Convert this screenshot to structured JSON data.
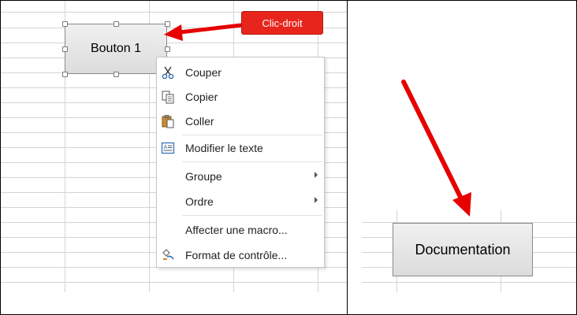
{
  "sheet_button": {
    "label": "Bouton 1"
  },
  "callout": {
    "label": "Clic-droit",
    "color": "#e8251c"
  },
  "context_menu": {
    "items": [
      {
        "label": "Couper",
        "icon": "scissors-icon",
        "submenu": false
      },
      {
        "label": "Copier",
        "icon": "copy-icon",
        "submenu": false
      },
      {
        "label": "Coller",
        "icon": "paste-icon",
        "submenu": false
      },
      {
        "label": "Modifier le texte",
        "icon": "edit-text-icon",
        "submenu": false
      },
      {
        "label": "Groupe",
        "icon": "",
        "submenu": true
      },
      {
        "label": "Ordre",
        "icon": "",
        "submenu": true
      },
      {
        "label": "Affecter une macro...",
        "icon": "",
        "submenu": false
      },
      {
        "label": "Format de contrôle...",
        "icon": "format-control-icon",
        "submenu": false
      }
    ]
  },
  "doc_button": {
    "label": "Documentation"
  },
  "colors": {
    "arrow": "#e60000",
    "gridline": "#d4d4d4"
  }
}
